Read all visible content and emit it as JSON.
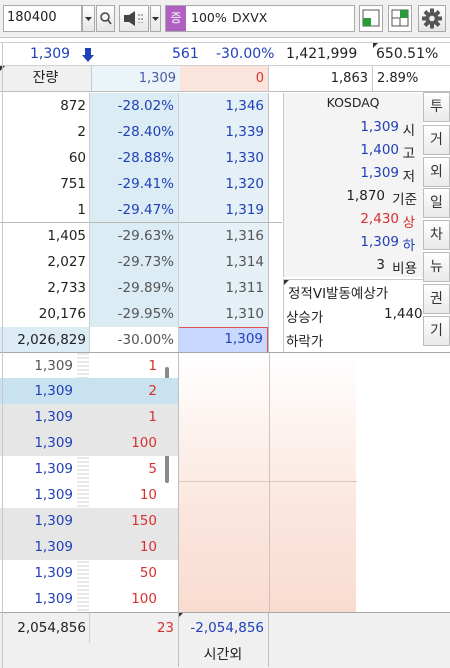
{
  "toolbar": {
    "code": "180400",
    "percent": "100%",
    "name": "DXVX",
    "tag": "증"
  },
  "price_line": {
    "price": "1,309",
    "volume_change": "561",
    "rate": "-30.00%",
    "total_volume": "1,421,999",
    "turnover": "650.51%"
  },
  "residual": {
    "label": "잔량",
    "ask_price": "1,309",
    "bid_volume": "0",
    "right_volume": "1,863",
    "right_rate": "2.89%"
  },
  "ask_rows": [
    {
      "qty": "872",
      "rate": "-28.02%",
      "price": "1,346"
    },
    {
      "qty": "2",
      "rate": "-28.40%",
      "price": "1,339"
    },
    {
      "qty": "60",
      "rate": "-28.88%",
      "price": "1,330"
    },
    {
      "qty": "751",
      "rate": "-29.41%",
      "price": "1,320"
    },
    {
      "qty": "1",
      "rate": "-29.47%",
      "price": "1,319"
    },
    {
      "qty": "1,405",
      "rate": "-29.63%",
      "price": "1,316"
    },
    {
      "qty": "2,027",
      "rate": "-29.73%",
      "price": "1,314"
    },
    {
      "qty": "2,733",
      "rate": "-29.89%",
      "price": "1,311"
    },
    {
      "qty": "20,176",
      "rate": "-29.95%",
      "price": "1,310"
    },
    {
      "qty": "2,026,829",
      "rate": "-30.00%",
      "price": "1,309"
    }
  ],
  "info": {
    "market": "KOSDAQ",
    "open_val": "1,309",
    "open_label": "시",
    "high_val": "1,400",
    "high_label": "고",
    "low_val": "1,309",
    "low_label": "저",
    "base_val": "1,870",
    "base_label": "기준",
    "upper_val": "2,430",
    "upper_label": "상",
    "lower_val": "1,309",
    "lower_label": "하",
    "cost_val": "3",
    "cost_label": "비용",
    "vi_title": "정적VI발동예상가",
    "vi_up_label": "상승가",
    "vi_up_val": "1,440",
    "vi_down_label": "하락가"
  },
  "side_buttons": [
    "투",
    "거",
    "외",
    "일",
    "차",
    "뉴",
    "권",
    "기"
  ],
  "trades": [
    {
      "price": "1,309",
      "qty": "1"
    },
    {
      "price": "1,309",
      "qty": "2"
    },
    {
      "price": "1,309",
      "qty": "1"
    },
    {
      "price": "1,309",
      "qty": "100"
    },
    {
      "price": "1,309",
      "qty": "5"
    },
    {
      "price": "1,309",
      "qty": "10"
    },
    {
      "price": "1,309",
      "qty": "150"
    },
    {
      "price": "1,309",
      "qty": "10"
    },
    {
      "price": "1,309",
      "qty": "50"
    },
    {
      "price": "1,309",
      "qty": "100"
    }
  ],
  "footer": {
    "total_ask": "2,054,856",
    "count": "23",
    "diff": "-2,054,856",
    "after_hours": "시간외"
  },
  "colors": {
    "ask_bg": "#dcecf4",
    "bid_bg": "#fbe4dc",
    "highlight": "#c8d8ff",
    "tag_purple": "#b060c0"
  }
}
